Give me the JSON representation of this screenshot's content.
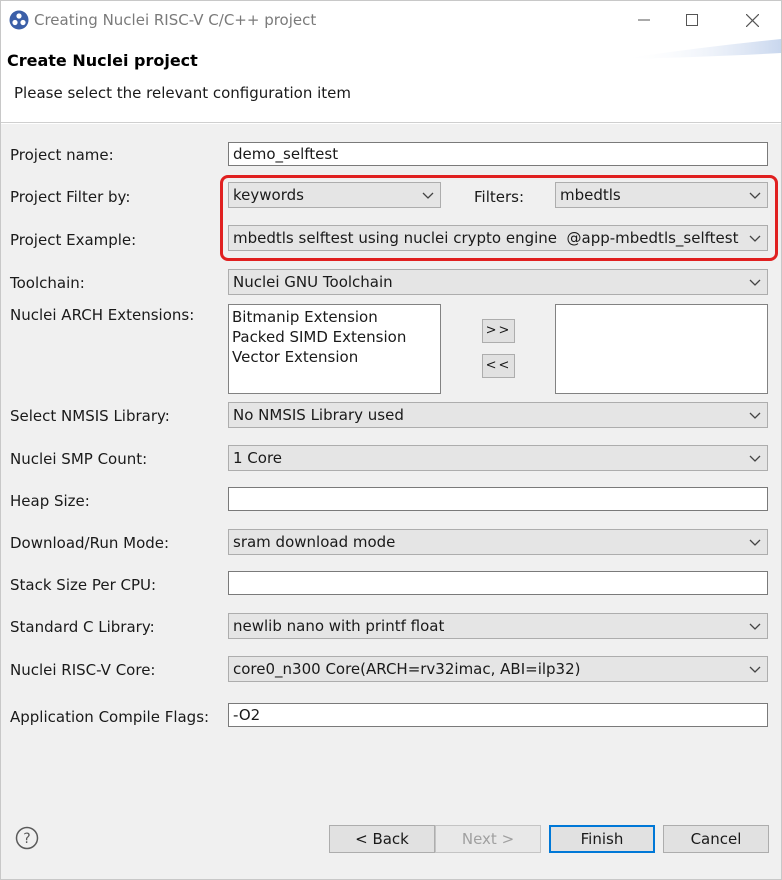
{
  "window": {
    "title": "Creating Nuclei RISC-V C/C++ project",
    "minimize_glyph": "—",
    "maximize_glyph": "☐",
    "close_glyph": "✕"
  },
  "header": {
    "title": "Create Nuclei project",
    "subtitle": "Please select the relevant configuration item"
  },
  "form": {
    "project_name": {
      "label": "Project name:",
      "value": "demo_selftest"
    },
    "filter_by": {
      "label": "Project Filter by:",
      "value": "keywords"
    },
    "filters": {
      "label": "Filters:",
      "value": "mbedtls"
    },
    "example": {
      "label": "Project Example:",
      "value": "mbedtls selftest using nuclei crypto engine  @app-mbedtls_selftest"
    },
    "toolchain": {
      "label": "Toolchain:",
      "value": "Nuclei GNU Toolchain"
    },
    "arch_ext": {
      "label": "Nuclei ARCH Extensions:",
      "available": [
        "Bitmanip Extension",
        "Packed SIMD Extension",
        "Vector Extension"
      ],
      "selected": [],
      "add_label": ">>",
      "remove_label": "<<"
    },
    "nmsis": {
      "label": "Select NMSIS Library:",
      "value": "No NMSIS Library used"
    },
    "smp": {
      "label": "Nuclei SMP Count:",
      "value": "1 Core"
    },
    "heap": {
      "label": "Heap Size:",
      "value": ""
    },
    "run_mode": {
      "label": "Download/Run Mode:",
      "value": "sram download mode"
    },
    "stack": {
      "label": "Stack Size Per CPU:",
      "value": ""
    },
    "stdc": {
      "label": "Standard C Library:",
      "value": "newlib nano with printf float"
    },
    "core": {
      "label": "Nuclei RISC-V Core:",
      "value": "core0_n300 Core(ARCH=rv32imac, ABI=ilp32)"
    },
    "flags": {
      "label": "Application Compile Flags:",
      "value": "-O2"
    }
  },
  "footer": {
    "back_label": "< Back",
    "next_label": "Next >",
    "finish_label": "Finish",
    "cancel_label": "Cancel",
    "help_glyph": "?"
  },
  "colors": {
    "highlight": "#e02020",
    "default_button_border": "#0078d7",
    "app_icon": "#3b5fa8"
  }
}
